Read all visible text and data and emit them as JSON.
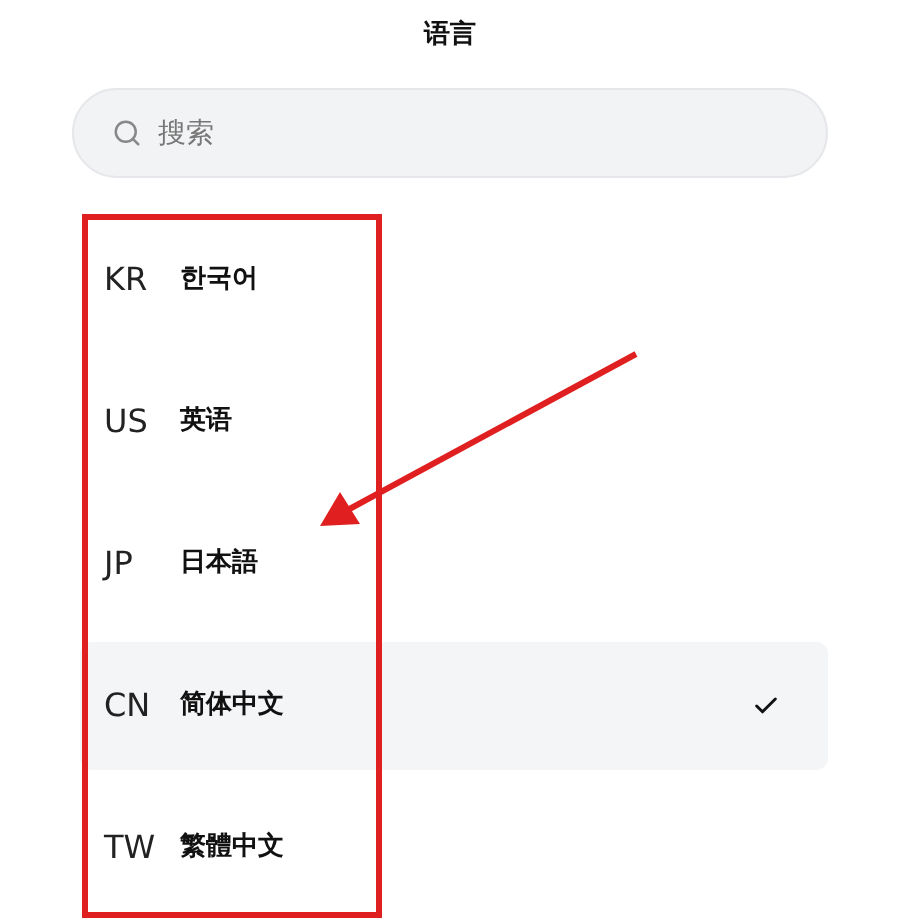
{
  "title": "语言",
  "search": {
    "placeholder": "搜索"
  },
  "languages": [
    {
      "code": "KR",
      "name": "한국어",
      "selected": false
    },
    {
      "code": "US",
      "name": "英语",
      "selected": false
    },
    {
      "code": "JP",
      "name": "日本語",
      "selected": false
    },
    {
      "code": "CN",
      "name": "简体中文",
      "selected": true
    },
    {
      "code": "TW",
      "name": "繁體中文",
      "selected": false
    }
  ]
}
